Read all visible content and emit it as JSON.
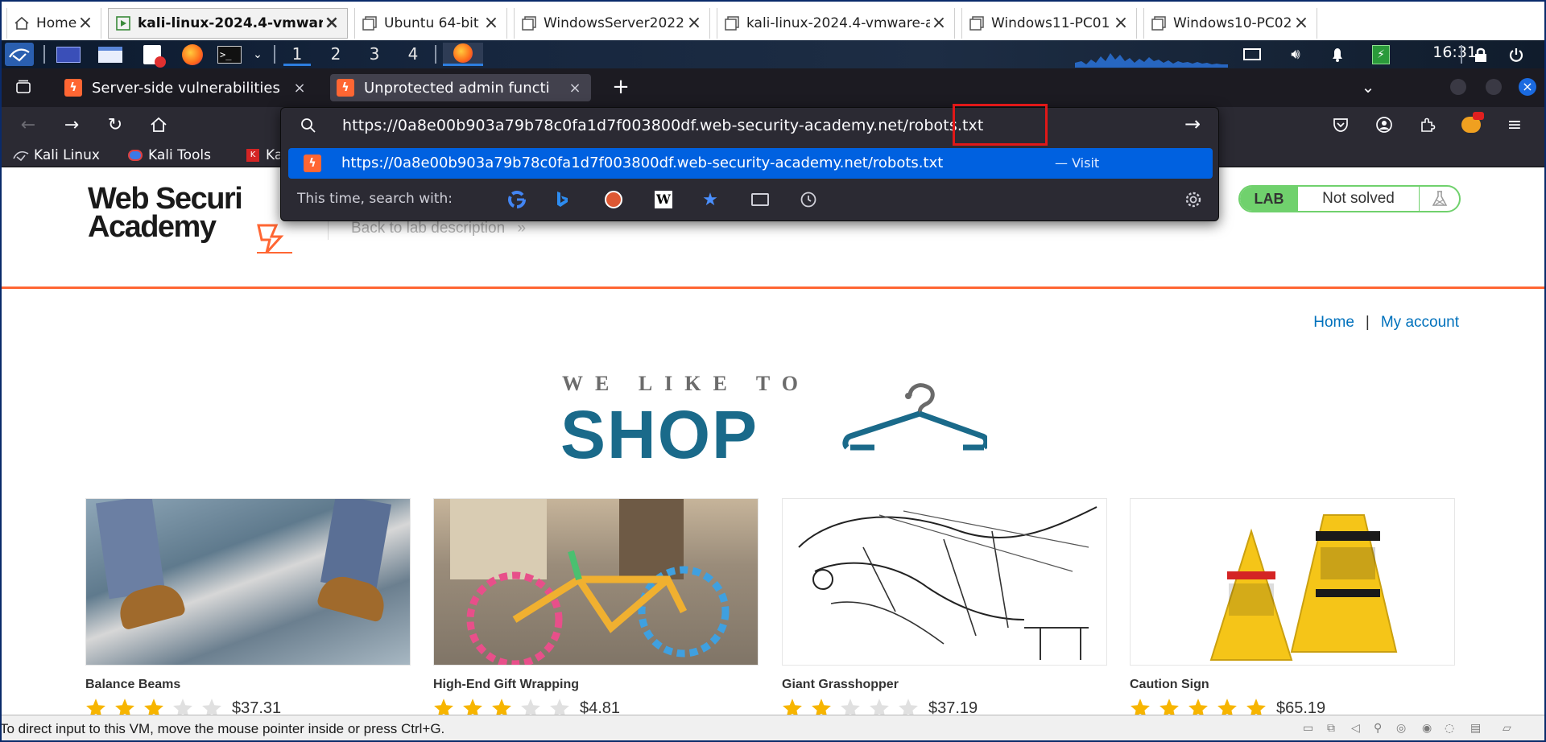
{
  "host_tabs": [
    {
      "label": "Home",
      "icon": "home-icon",
      "active": false
    },
    {
      "label": "kali-linux-2024.4-vmware-...",
      "icon": "vm-icon",
      "active": true
    },
    {
      "label": "Ubuntu 64-bit",
      "icon": "vm-icon",
      "active": false
    },
    {
      "label": "WindowsServer2022",
      "icon": "vm-icon",
      "active": false
    },
    {
      "label": "kali-linux-2024.4-vmware-am...",
      "icon": "vm-icon",
      "active": false
    },
    {
      "label": "Windows11-PC01",
      "icon": "vm-icon",
      "active": false
    },
    {
      "label": "Windows10-PC02",
      "icon": "vm-icon",
      "active": false
    }
  ],
  "kali_panel": {
    "workspaces": [
      "1",
      "2",
      "3",
      "4"
    ],
    "active_workspace": "1",
    "clock": "16:31"
  },
  "firefox": {
    "tabs": [
      {
        "label": "Server-side vulnerabilities",
        "active": false
      },
      {
        "label": "Unprotected admin functi",
        "active": true
      }
    ],
    "new_tab_symbol": "+",
    "url": "https://0a8e00b903a79b78c0fa1d7f003800df.web-security-academy.net/robots.txt",
    "suggestion_url": "https://0a8e00b903a79b78c0fa1d7f003800df.web-security-academy.net/robots.txt",
    "suggestion_action": "— Visit",
    "search_with_label": "This time, search with:",
    "bookmarks": [
      {
        "label": "Kali Linux",
        "icon": "kali-dragon-icon"
      },
      {
        "label": "Kali Tools",
        "icon": "kali-tools-icon"
      },
      {
        "label": "Ka",
        "icon": "kali-docs-icon"
      }
    ]
  },
  "page": {
    "logo_line1": "Web Securi",
    "logo_line2": "Academy",
    "back_link": "Back to lab description",
    "back_link_arrow": "»",
    "lab_label": "LAB",
    "lab_status": "Not solved",
    "nav_home": "Home",
    "nav_sep": "|",
    "nav_account": "My account",
    "banner_small": "WE LIKE TO",
    "banner_big": "SHOP",
    "products": [
      {
        "name": "Balance Beams",
        "price": "$37.31",
        "rating": 3
      },
      {
        "name": "High-End Gift Wrapping",
        "price": "$4.81",
        "rating": 3
      },
      {
        "name": "Giant Grasshopper",
        "price": "$37.19",
        "rating": 2
      },
      {
        "name": "Caution Sign",
        "price": "$65.19",
        "rating": 5
      }
    ]
  },
  "vm_status": {
    "text": "To direct input to this VM, move the mouse pointer inside or press Ctrl+G."
  },
  "colors": {
    "accent_orange": "#ff6633",
    "link_blue": "#0071bc",
    "firefox_highlight": "#0061e0",
    "lab_green": "#70d16d",
    "star_gold": "#f7b500",
    "shop_teal": "#1a6a8a"
  }
}
